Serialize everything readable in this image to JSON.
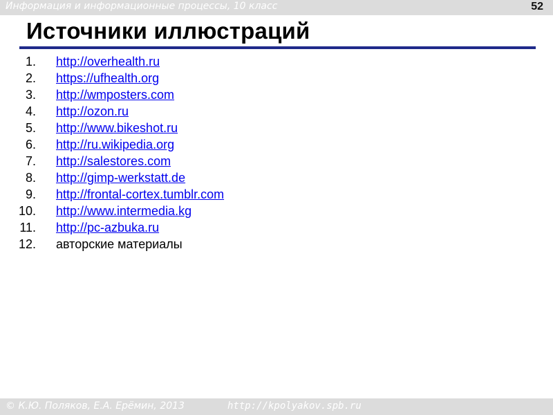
{
  "header": {
    "title": "Информация и информационные процессы, 10 класс",
    "page_number": "52"
  },
  "slide": {
    "title": "Источники иллюстраций",
    "items": [
      {
        "number": "1.",
        "text": "http://overhealth.ru"
      },
      {
        "number": "2.",
        "text": "https://ufhealth.org"
      },
      {
        "number": "3.",
        "text": "http://wmposters.com"
      },
      {
        "number": "4.",
        "text": "http://ozon.ru"
      },
      {
        "number": "5.",
        "text": "http://www.bikeshot.ru"
      },
      {
        "number": "6.",
        "text": "http://ru.wikipedia.org"
      },
      {
        "number": "7.",
        "text": "http://salestores.com"
      },
      {
        "number": "8.",
        "text": "http://gimp-werkstatt.de"
      },
      {
        "number": "9.",
        "text": "http://frontal-cortex.tumblr.com"
      },
      {
        "number": "10.",
        "text": "http://www.intermedia.kg"
      },
      {
        "number": "11.",
        "text": "http://pc-azbuka.ru"
      },
      {
        "number": "12.",
        "text": "авторские материалы"
      }
    ]
  },
  "footer": {
    "author": "© К.Ю. Поляков, Е.А. Ерёмин, 2013",
    "url": "http://kpolyakov.spb.ru"
  },
  "colors": {
    "link": "#0000ee",
    "rule": "#1f2a8a",
    "band": "#dcdcdc"
  }
}
